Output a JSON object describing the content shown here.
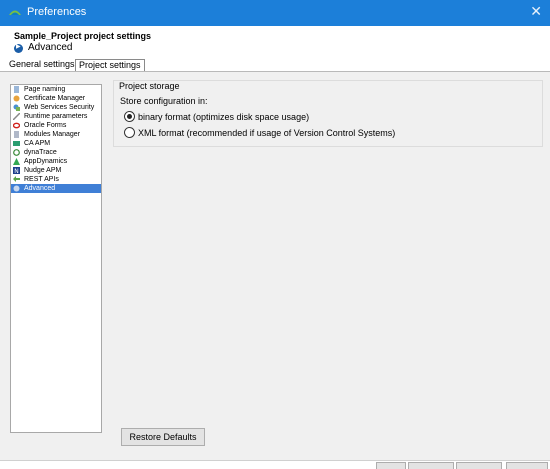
{
  "window": {
    "title": "Preferences",
    "close_glyph": "✕"
  },
  "header": {
    "project_title": "Sample_Project project settings",
    "subtitle": "Advanced",
    "subtitle_icon": "arrow-circle-icon"
  },
  "tabs": [
    {
      "label": "General settings"
    },
    {
      "label": "Project settings"
    }
  ],
  "nav": {
    "items": [
      {
        "label": "Page naming",
        "icon": "page-icon"
      },
      {
        "label": "Certificate Manager",
        "icon": "certificate-icon"
      },
      {
        "label": "Web Services Security",
        "icon": "web-security-icon"
      },
      {
        "label": "Runtime parameters",
        "icon": "runtime-icon"
      },
      {
        "label": "Oracle Forms",
        "icon": "oracle-icon"
      },
      {
        "label": "Modules Manager",
        "icon": "modules-icon"
      },
      {
        "label": "CA APM",
        "icon": "ca-icon"
      },
      {
        "label": "dynaTrace",
        "icon": "dynatrace-icon"
      },
      {
        "label": "AppDynamics",
        "icon": "appdynamics-icon"
      },
      {
        "label": "Nudge APM",
        "icon": "nudge-icon"
      },
      {
        "label": "REST APIs",
        "icon": "rest-icon"
      },
      {
        "label": "Advanced",
        "icon": "advanced-icon"
      }
    ],
    "selected": "Advanced"
  },
  "storage": {
    "group_title": "Project storage",
    "label": "Store configuration in:",
    "options": [
      {
        "label": "binary format (optimizes disk space usage)",
        "checked": true
      },
      {
        "label": "XML format (recommended if usage of Version Control Systems)",
        "checked": false
      }
    ]
  },
  "buttons": {
    "restore": "Restore Defaults"
  },
  "colors": {
    "titlebar": "#1c7fd9",
    "selection": "#3f7fd6",
    "panel": "#f0f0f0"
  }
}
